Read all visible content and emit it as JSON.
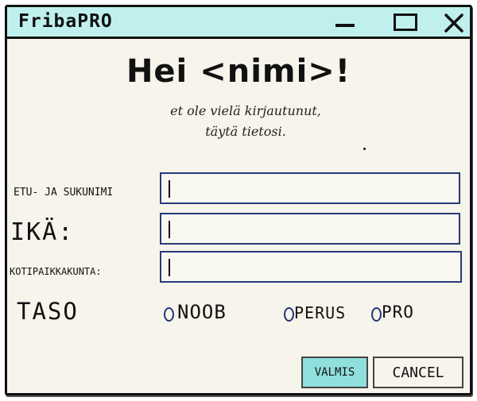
{
  "window": {
    "title": "FribaPRO",
    "controls": {
      "minimize_icon": "minimize-icon",
      "maximize_icon": "maximize-icon",
      "close_icon": "close-icon"
    }
  },
  "header": {
    "greeting": "Hei <nimi>!",
    "subtitle_line1": "et ole vielä kirjautunut,",
    "subtitle_line2": "täytä tietosi."
  },
  "form": {
    "fields": [
      {
        "label": "ETU- JA SUKUNIMI",
        "value": ""
      },
      {
        "label": "IKÄ:",
        "value": ""
      },
      {
        "label": "KOTIPAIKKAKUNTA:",
        "value": ""
      }
    ],
    "level": {
      "label": "TASO",
      "options": [
        "NOOB",
        "PERUS",
        "PRO"
      ]
    }
  },
  "buttons": {
    "ok": "VALMIS",
    "cancel": "CANCEL"
  },
  "colors": {
    "titlebar": "#bff0ee",
    "window_bg": "#f6f4eb",
    "input_border": "#283a7a",
    "primary_button": "#8fe0dc"
  }
}
